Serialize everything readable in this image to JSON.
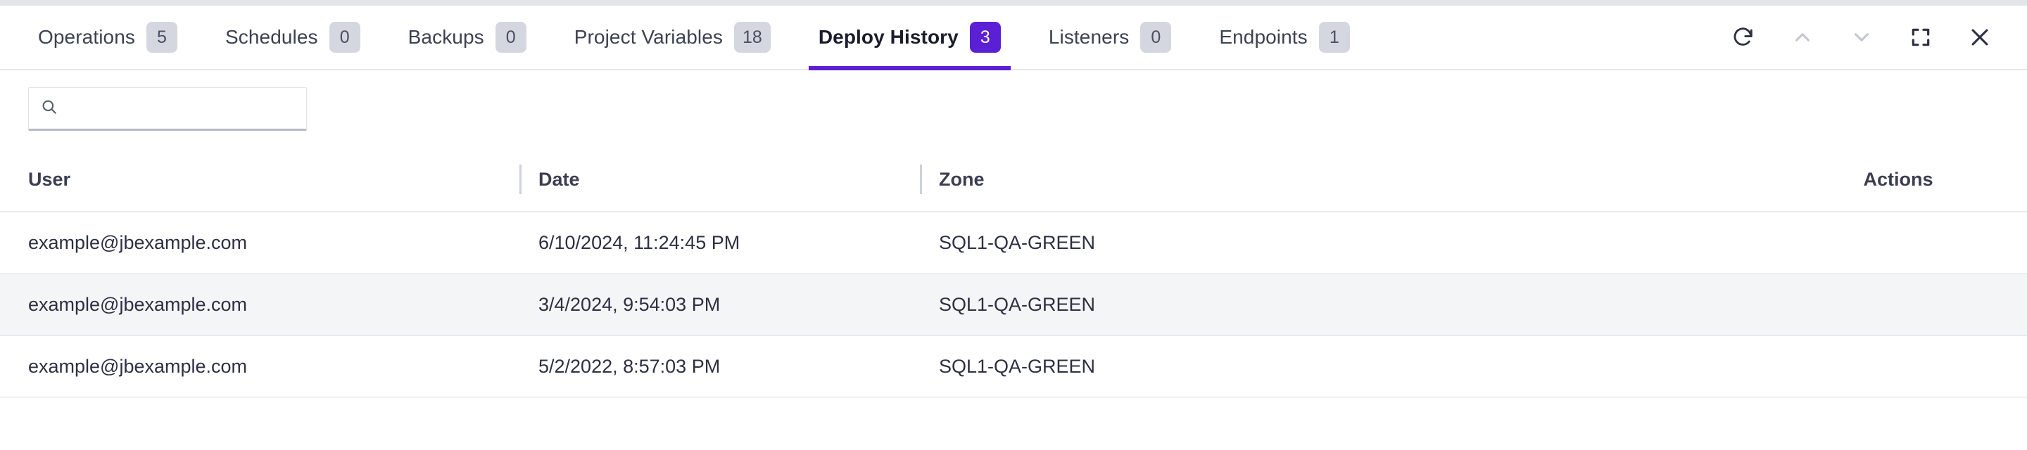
{
  "tabs": [
    {
      "label": "Operations",
      "badge": "5",
      "active": false
    },
    {
      "label": "Schedules",
      "badge": "0",
      "active": false
    },
    {
      "label": "Backups",
      "badge": "0",
      "active": false
    },
    {
      "label": "Project Variables",
      "badge": "18",
      "active": false
    },
    {
      "label": "Deploy History",
      "badge": "3",
      "active": true
    },
    {
      "label": "Listeners",
      "badge": "0",
      "active": false
    },
    {
      "label": "Endpoints",
      "badge": "1",
      "active": false
    }
  ],
  "window_controls": [
    {
      "name": "refresh-icon",
      "title": "Refresh"
    },
    {
      "name": "chevron-up-icon",
      "title": "Previous"
    },
    {
      "name": "chevron-down-icon",
      "title": "Next"
    },
    {
      "name": "fullscreen-icon",
      "title": "Fullscreen"
    },
    {
      "name": "close-icon",
      "title": "Close"
    }
  ],
  "search": {
    "value": "",
    "placeholder": "",
    "icon": "search-icon"
  },
  "table": {
    "columns": [
      "User",
      "Date",
      "Zone",
      "Actions"
    ],
    "rows": [
      {
        "user": "example@jbexample.com",
        "date": "6/10/2024, 11:24:45 PM",
        "zone": "SQL1-QA-GREEN",
        "actions": ""
      },
      {
        "user": "example@jbexample.com",
        "date": "3/4/2024, 9:54:03 PM",
        "zone": "SQL1-QA-GREEN",
        "actions": ""
      },
      {
        "user": "example@jbexample.com",
        "date": "5/2/2022, 8:57:03 PM",
        "zone": "SQL1-QA-GREEN",
        "actions": ""
      }
    ]
  },
  "colors": {
    "accent_purple": "#5b1fd6",
    "badge_gray": "#d5d7e0",
    "text_dark": "#2d3043",
    "stripe": "#f4f5f7",
    "border": "#e6e7ec"
  }
}
